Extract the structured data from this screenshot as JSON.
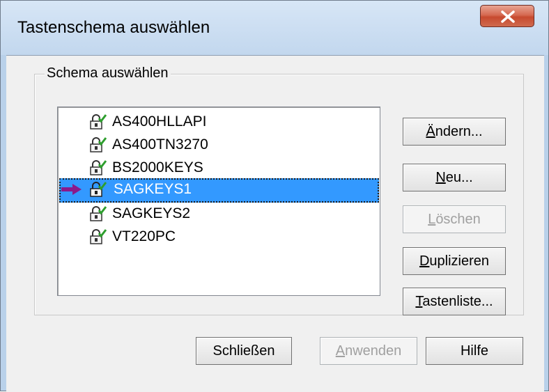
{
  "window": {
    "title": "Tastenschema auswählen",
    "close_label": "X"
  },
  "group": {
    "legend": "Schema auswählen"
  },
  "scheme_list": {
    "items": [
      {
        "label": "AS400HLLAPI",
        "icon": "lock-icon",
        "selected": false
      },
      {
        "label": "AS400TN3270",
        "icon": "lock-icon",
        "selected": false
      },
      {
        "label": "BS2000KEYS",
        "icon": "lock-icon",
        "selected": false
      },
      {
        "label": "SAGKEYS1",
        "icon": "lock-icon",
        "selected": true,
        "marker": "arrow-right-icon"
      },
      {
        "label": "SAGKEYS2",
        "icon": "lock-icon",
        "selected": false
      },
      {
        "label": "VT220PC",
        "icon": "lock-icon",
        "selected": false
      }
    ]
  },
  "side_buttons": {
    "aendern": {
      "pre": "",
      "mnemonic": "Ä",
      "post": "ndern...",
      "enabled": true
    },
    "neu": {
      "pre": "",
      "mnemonic": "N",
      "post": "eu...",
      "enabled": true
    },
    "loeschen": {
      "pre": "",
      "mnemonic": "L",
      "post": "öschen",
      "enabled": false
    },
    "duplizieren": {
      "pre": "",
      "mnemonic": "D",
      "post": "uplizieren",
      "enabled": true
    },
    "tastenliste": {
      "pre": "",
      "mnemonic": "T",
      "post": "astenliste...",
      "enabled": true
    }
  },
  "footer_buttons": {
    "schliessen": {
      "label": "Schließen",
      "enabled": true
    },
    "anwenden": {
      "pre": "",
      "mnemonic": "A",
      "post": "nwenden",
      "enabled": false
    },
    "hilfe": {
      "label": "Hilfe",
      "enabled": true
    }
  },
  "colors": {
    "selection": "#3399ff",
    "arrow": "#8b1a8b",
    "lock_check": "#2e9e2e",
    "close_button": "#c74a2f"
  }
}
